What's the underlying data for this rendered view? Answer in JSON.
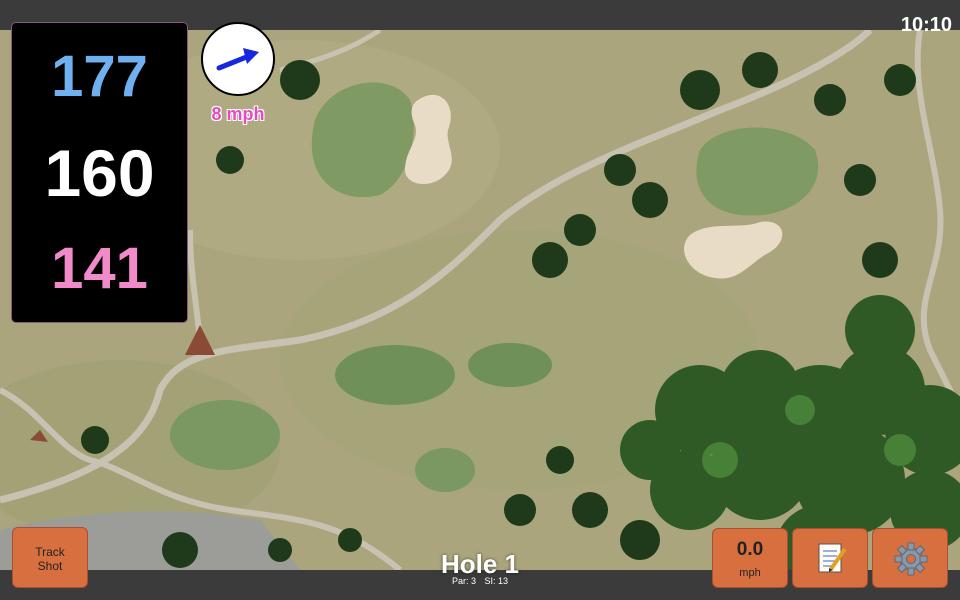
{
  "status_bar": {
    "time": "10:10"
  },
  "distances": {
    "back": "177",
    "middle": "160",
    "front": "141"
  },
  "wind": {
    "speed": "8 mph",
    "icon": "wind-direction-arrow-icon",
    "direction": "east-northeast"
  },
  "buttons": {
    "track_shot_line1": "Track",
    "track_shot_line2": "Shot",
    "speed_value": "0.0",
    "speed_unit": "mph",
    "notes_icon": "notepad-icon",
    "settings_icon": "gear-icon"
  },
  "hole": {
    "title": "Hole 1",
    "par": "Par: 3",
    "si": "SI: 13"
  },
  "colors": {
    "back_distance": "#6eb0f0",
    "middle_distance": "#ffffff",
    "front_distance": "#f08ac8",
    "accent_button": "#d86f3f",
    "wind_speed": "#e74bc0"
  }
}
